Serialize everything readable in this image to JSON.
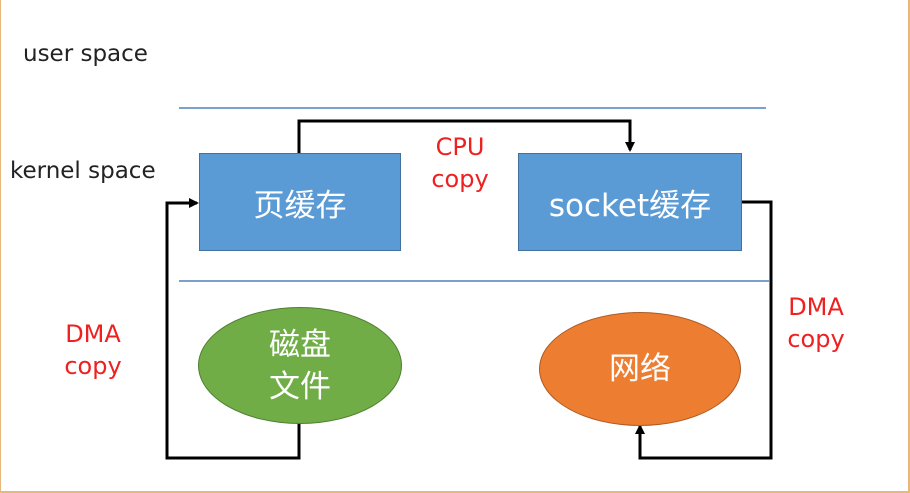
{
  "labels": {
    "user_space": "user space",
    "kernel_space": "kernel space"
  },
  "nodes": {
    "page_cache": "页缓存",
    "socket_cache": "socket缓存",
    "disk_file": "磁盘\n文件",
    "network": "网络"
  },
  "copy_labels": {
    "cpu_copy": "CPU\ncopy",
    "dma_copy_left": "DMA\ncopy",
    "dma_copy_right": "DMA\ncopy"
  },
  "colors": {
    "box_fill": "#5b9bd5",
    "disk_fill": "#70ad47",
    "network_fill": "#ed7d31",
    "copy_label_color": "#ee2020",
    "divider_color": "#4f81bd"
  }
}
